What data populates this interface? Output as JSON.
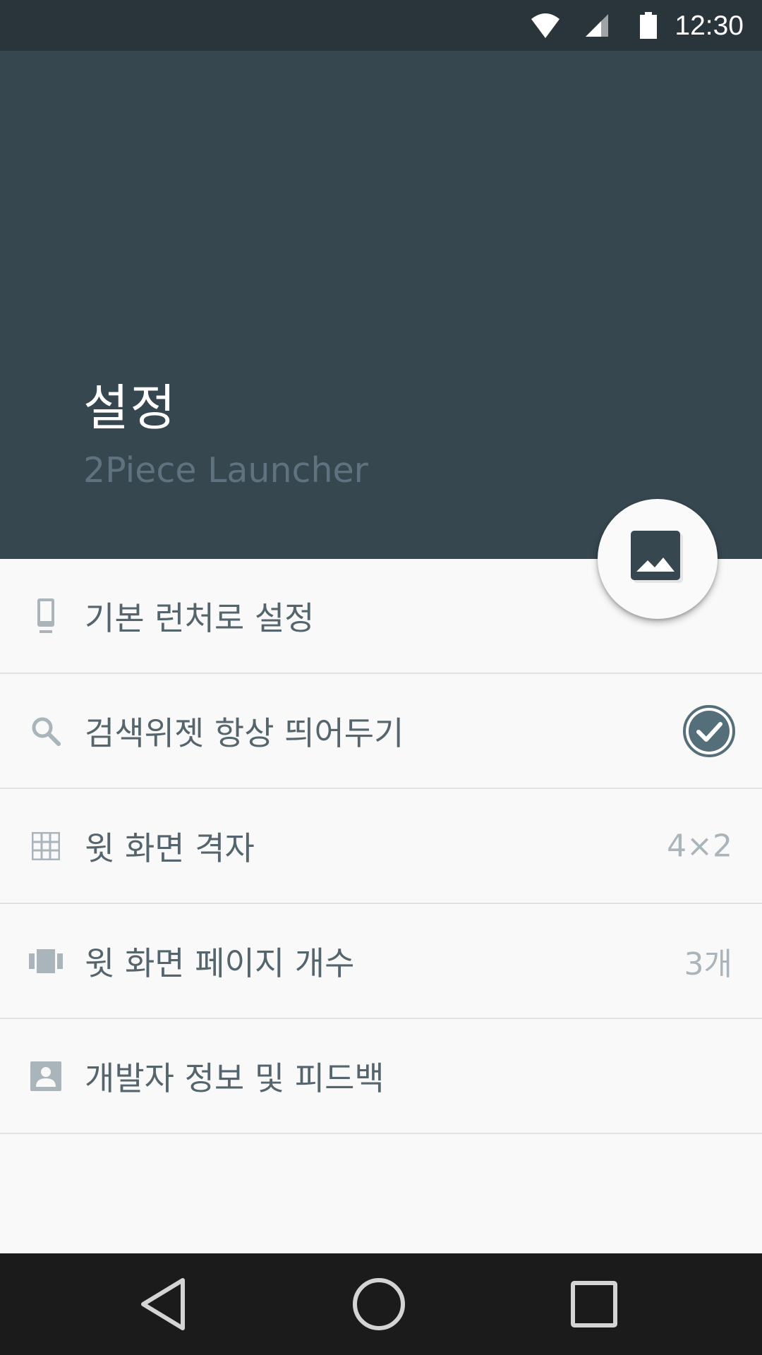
{
  "status_bar": {
    "time": "12:30",
    "icons": [
      "wifi-icon",
      "cell-signal-icon",
      "battery-icon"
    ]
  },
  "header": {
    "title": "설정",
    "subtitle": "2Piece Launcher",
    "background_color": "#37474f"
  },
  "fab": {
    "icon": "image-icon"
  },
  "settings": {
    "items": [
      {
        "icon": "phone-icon",
        "label": "기본 런처로 설정",
        "value": ""
      },
      {
        "icon": "search-icon",
        "label": "검색위젯 항상 띄어두기",
        "checked": true
      },
      {
        "icon": "grid-icon",
        "label": "윗 화면 격자",
        "value": "4×2"
      },
      {
        "icon": "carousel-icon",
        "label": "윗 화면 페이지 개수",
        "value": "3개"
      },
      {
        "icon": "contact-icon",
        "label": "개발자 정보 및 피드백",
        "value": ""
      }
    ]
  },
  "nav_bar": {
    "buttons": [
      "back-icon",
      "home-icon",
      "recents-icon"
    ]
  },
  "colors": {
    "status_bar": "#2a343b",
    "accent": "#546e7a",
    "text": "#55656d",
    "value_text": "#a9b5bb"
  }
}
